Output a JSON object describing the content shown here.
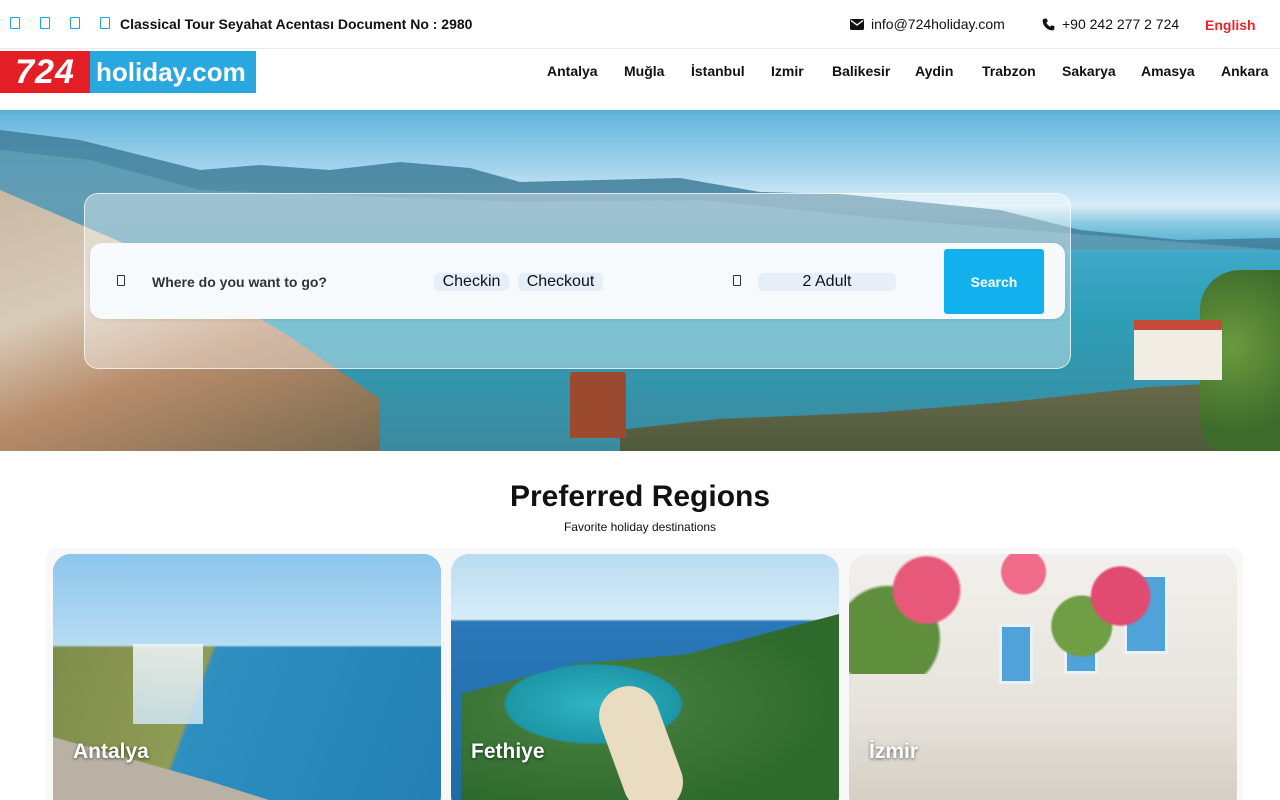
{
  "topbar": {
    "social_icons": [
      "facebook-icon",
      "twitter-icon",
      "instagram-icon",
      "youtube-icon"
    ],
    "agency_text": "Classical Tour Seyahat Acentası Document No : 2980",
    "email": "info@724holiday.com",
    "phone": "+90 242 277 2 724",
    "language": "English"
  },
  "header": {
    "logo_number": "724",
    "logo_text": "holiday.com",
    "nav": [
      "Antalya",
      "Muğla",
      "İstanbul",
      "Izmir",
      "Balikesir",
      "Aydin",
      "Trabzon",
      "Sakarya",
      "Amasya",
      "Ankara"
    ]
  },
  "search": {
    "destination_placeholder": "Where do you want to go?",
    "checkin": "Checkin",
    "checkout": "Checkout",
    "guests": "2 Adult",
    "button": "Search"
  },
  "regions": {
    "title": "Preferred Regions",
    "subtitle": "Favorite holiday destinations",
    "cards": [
      {
        "name": "Antalya"
      },
      {
        "name": "Fethiye"
      },
      {
        "name": "İzmir"
      }
    ]
  },
  "colors": {
    "accent": "#12b0ec",
    "logo_red": "#e31e24",
    "logo_blue": "#29a8e0",
    "language_red": "#e8262a"
  }
}
